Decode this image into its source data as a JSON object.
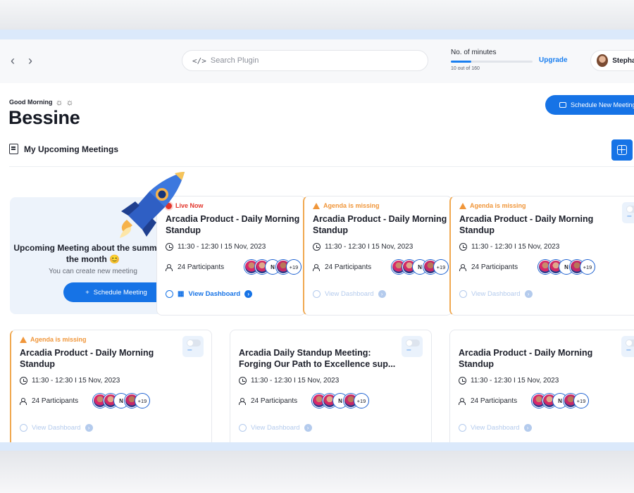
{
  "topbar": {
    "search_placeholder": "Search Plugin",
    "search_icon": "code-icon",
    "minutes_label": "No. of minutes",
    "minutes_used": "10 out of 160",
    "minutes_fraction": 0.0625,
    "upgrade_label": "Upgrade",
    "user_name": "Stephanie"
  },
  "greeting": {
    "text": "Good Morning",
    "name": "Bessine",
    "schedule_new_label": "Schedule New Meeting"
  },
  "section": {
    "title": "My Upcoming Meetings"
  },
  "promo": {
    "title": "Upcoming Meeting about the summit of the month 😊",
    "description": "You can create new meeting",
    "button_label": "Schedule Meeting"
  },
  "cards": [
    {
      "status": "Live Now",
      "title": "Arcadia Product - Daily Morning Standup",
      "time": "11:30 - 12:30 I 15 Nov, 2023",
      "participants": "24 Participants",
      "avatar_more": "+19",
      "avatar_initial": "N",
      "dashboard_label": "View Dashboard"
    },
    {
      "status": "Agenda is missing",
      "title": "Arcadia Product - Daily Morning Standup",
      "time": "11:30 - 12:30 I 15 Nov, 2023",
      "participants": "24 Participants",
      "avatar_more": "+19",
      "avatar_initial": "N",
      "dashboard_label": "View Dashboard"
    },
    {
      "status": "Agenda is missing",
      "title": "Arcadia Product - Daily Morning Standup",
      "time": "11:30 - 12:30 I 15 Nov, 2023",
      "participants": "24 Participants",
      "avatar_more": "+19",
      "avatar_initial": "N",
      "dashboard_label": "View Dashboard"
    },
    {
      "status": "Agenda is missing",
      "title": "Arcadia Product - Daily Morning Standup",
      "time": "11:30 - 12:30 I 15 Nov, 2023",
      "participants": "24 Participants",
      "avatar_more": "+19",
      "avatar_initial": "N",
      "dashboard_label": "View Dashboard"
    },
    {
      "status": "",
      "title": "Arcadia Daily Standup Meeting: Forging Our Path to Excellence sup...",
      "time": "11:30 - 12:30 I 15 Nov, 2023",
      "participants": "24 Participants",
      "avatar_more": "+19",
      "avatar_initial": "N",
      "dashboard_label": "View Dashboard"
    },
    {
      "status": "",
      "title": "Arcadia Product - Daily Morning Standup",
      "time": "11:30 - 12:30 I 15 Nov, 2023",
      "participants": "24 Participants",
      "avatar_more": "+19",
      "avatar_initial": "N",
      "dashboard_label": "View Dashboard"
    }
  ],
  "colors": {
    "primary": "#1673e6",
    "live": "#e3352b",
    "warning": "#f0963a"
  }
}
